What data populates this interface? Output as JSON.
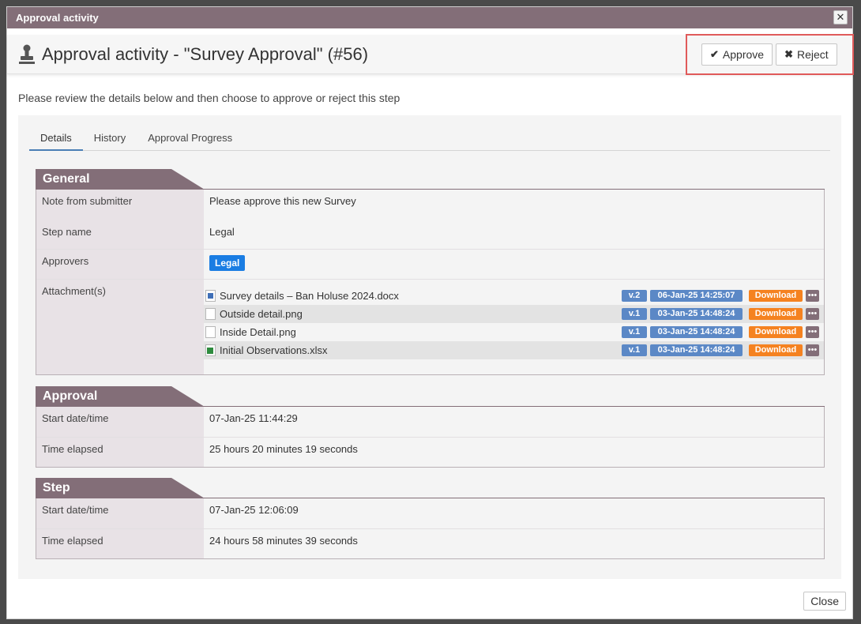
{
  "dialog": {
    "window_title": "Approval activity",
    "close_glyph": "✕",
    "title": "Approval activity - \"Survey Approval\" (#56)",
    "approve_label": "Approve",
    "reject_label": "Reject",
    "approve_glyph": "✔",
    "reject_glyph": "✖",
    "intro": "Please review the details below and then choose to approve or reject this step",
    "close_label": "Close"
  },
  "tabs": [
    "Details",
    "History",
    "Approval Progress"
  ],
  "general": {
    "heading": "General",
    "note_label": "Note from submitter",
    "note_value": "Please approve this new Survey",
    "step_label": "Step name",
    "step_value": "Legal",
    "approvers_label": "Approvers",
    "approvers_value": "Legal",
    "attachments_label": "Attachment(s)",
    "attachments": [
      {
        "name": "Survey details – Ban Holuse 2024.docx",
        "version": "v.2",
        "date": "06-Jan-25 14:25:07",
        "download": "Download",
        "icon": "word-file-icon"
      },
      {
        "name": "Outside detail.png",
        "version": "v.1",
        "date": "03-Jan-25 14:48:24",
        "download": "Download",
        "icon": "file-icon"
      },
      {
        "name": "Inside Detail.png",
        "version": "v.1",
        "date": "03-Jan-25 14:48:24",
        "download": "Download",
        "icon": "file-icon"
      },
      {
        "name": "Initial Observations.xlsx",
        "version": "v.1",
        "date": "03-Jan-25 14:48:24",
        "download": "Download",
        "icon": "excel-file-icon"
      }
    ],
    "more_glyph": "•••"
  },
  "approval": {
    "heading": "Approval",
    "start_label": "Start date/time",
    "start_value": "07-Jan-25 11:44:29",
    "elapsed_label": "Time elapsed",
    "elapsed_value": "25 hours 20 minutes 19 seconds"
  },
  "step": {
    "heading": "Step",
    "start_label": "Start date/time",
    "start_value": "07-Jan-25 12:06:09",
    "elapsed_label": "Time elapsed",
    "elapsed_value": "24 hours 58 minutes 39 seconds"
  },
  "colors": {
    "brand": "#836e78",
    "badge_blue": "#1a7de3",
    "version_blue": "#5b88c6",
    "download_orange": "#f58220",
    "highlight_red": "#e05a5a"
  }
}
